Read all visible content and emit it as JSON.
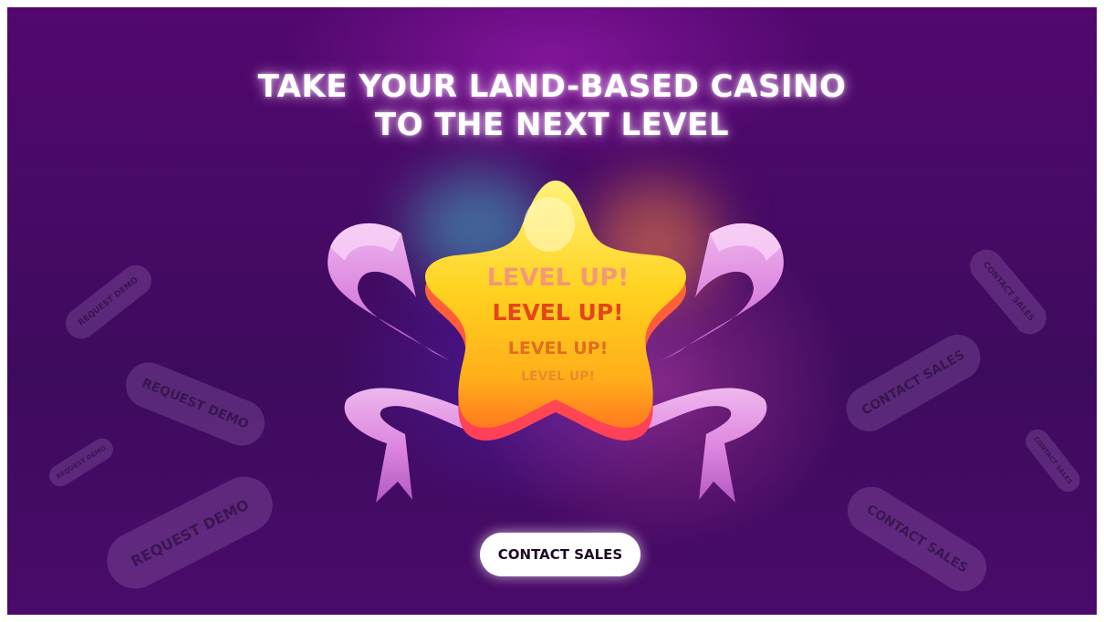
{
  "headline": {
    "line1": "TAKE YOUR LAND-BASED CASINO",
    "line2": "TO THE NEXT LEVEL"
  },
  "star": {
    "text1": "LEVEL UP!",
    "text2": "LEVEL UP!",
    "text3": "LEVEL UP!",
    "text4": "LEVEL UP!"
  },
  "pills_left": {
    "p1": "REQUEST DEMO",
    "p2": "REQUEST DEMO",
    "p3": "REQUEST DEMO",
    "p4": "REQUEST DEMO"
  },
  "pills_right": {
    "p1": "CONTACT SALES",
    "p2": "CONTACT SALES",
    "p3": "CONTACT SALES",
    "p4": "CONTACT SALES"
  },
  "cta": {
    "label": "CONTACT SALES"
  },
  "colors": {
    "background": "#470a66",
    "star": "#ffd21e",
    "ribbon": "#e89ae8",
    "cta_bg": "#ffffff"
  }
}
